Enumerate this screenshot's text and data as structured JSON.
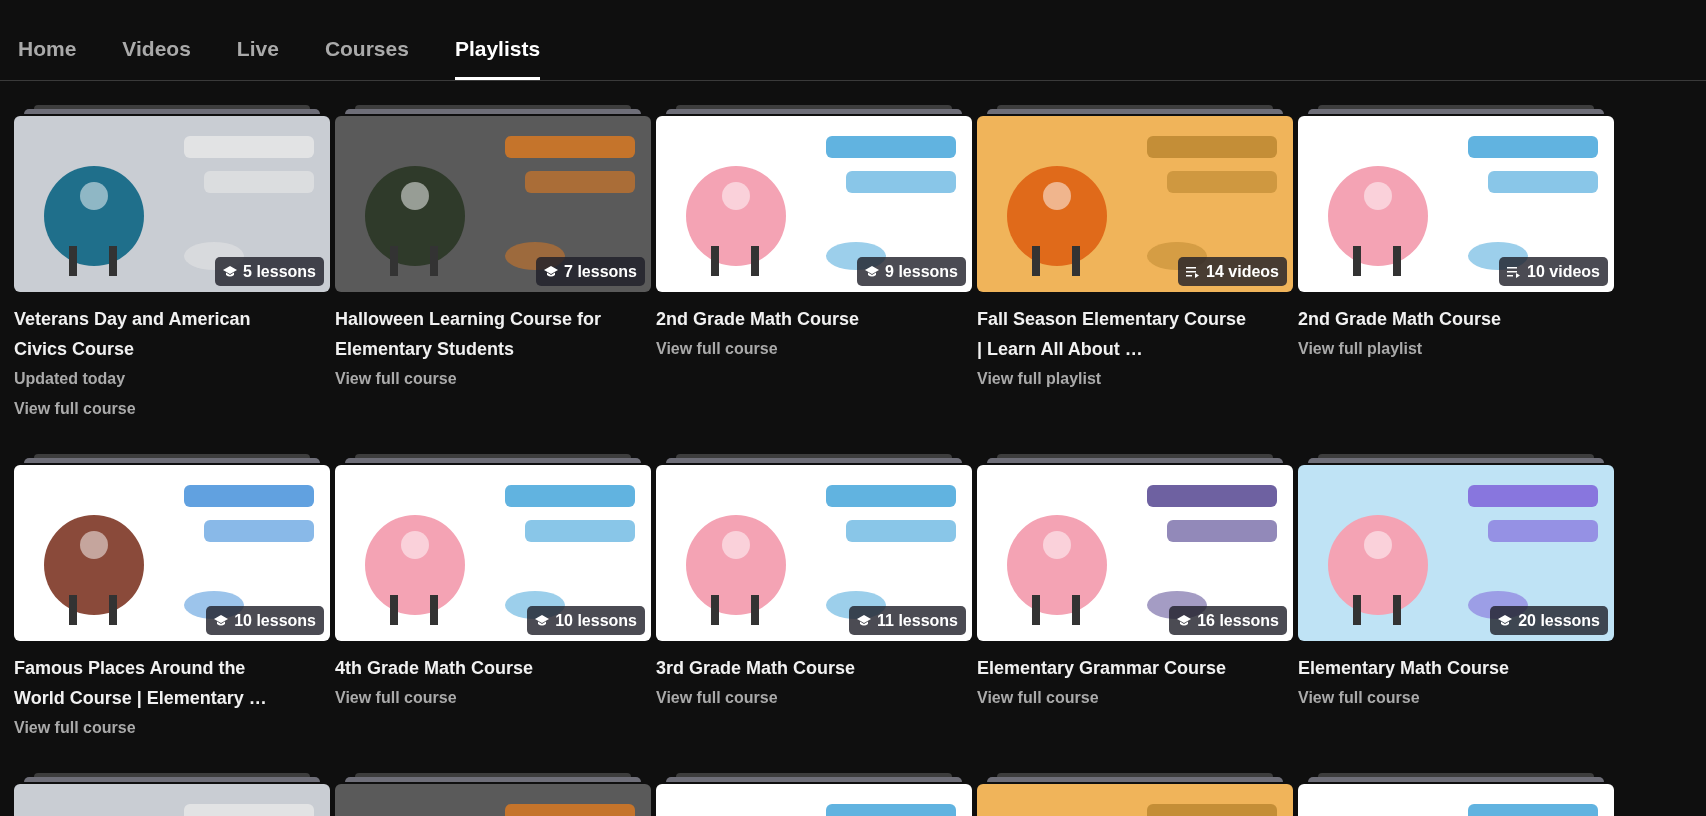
{
  "tabs": [
    {
      "label": "Home",
      "selected": false
    },
    {
      "label": "Videos",
      "selected": false
    },
    {
      "label": "Live",
      "selected": false
    },
    {
      "label": "Courses",
      "selected": false
    },
    {
      "label": "Playlists",
      "selected": true
    }
  ],
  "playlists": [
    {
      "badge": {
        "kind": "lessons",
        "text": "5 lessons"
      },
      "title": "Veterans Day and American Civics Course",
      "meta": [
        "Updated today",
        "View full course"
      ]
    },
    {
      "badge": {
        "kind": "lessons",
        "text": "7 lessons"
      },
      "title": "Halloween Learning Course for Elementary Students",
      "meta": [
        "View full course"
      ]
    },
    {
      "badge": {
        "kind": "lessons",
        "text": "9 lessons"
      },
      "title": "2nd Grade Math Course",
      "meta": [
        "View full course"
      ]
    },
    {
      "badge": {
        "kind": "videos",
        "text": "14 videos"
      },
      "title": "Fall Season Elementary Course | Learn All About …",
      "meta": [
        "View full playlist"
      ]
    },
    {
      "badge": {
        "kind": "videos",
        "text": "10 videos"
      },
      "title": "2nd Grade Math Course",
      "meta": [
        "View full playlist"
      ]
    },
    {
      "badge": {
        "kind": "lessons",
        "text": "10 lessons"
      },
      "title": "Famous Places Around the World Course | Elementary …",
      "meta": [
        "View full course"
      ]
    },
    {
      "badge": {
        "kind": "lessons",
        "text": "10 lessons"
      },
      "title": "4th Grade Math Course",
      "meta": [
        "View full course"
      ]
    },
    {
      "badge": {
        "kind": "lessons",
        "text": "11 lessons"
      },
      "title": "3rd Grade Math Course",
      "meta": [
        "View full course"
      ]
    },
    {
      "badge": {
        "kind": "lessons",
        "text": "16 lessons"
      },
      "title": "Elementary Grammar Course",
      "meta": [
        "View full course"
      ]
    },
    {
      "badge": {
        "kind": "lessons",
        "text": "20 lessons"
      },
      "title": "Elementary Math Course",
      "meta": [
        "View full course"
      ]
    },
    {
      "kind": "picture"
    },
    {
      "kind": "picture"
    },
    {
      "kind": "picture"
    },
    {
      "kind": "picture"
    },
    {
      "kind": "picture"
    }
  ]
}
